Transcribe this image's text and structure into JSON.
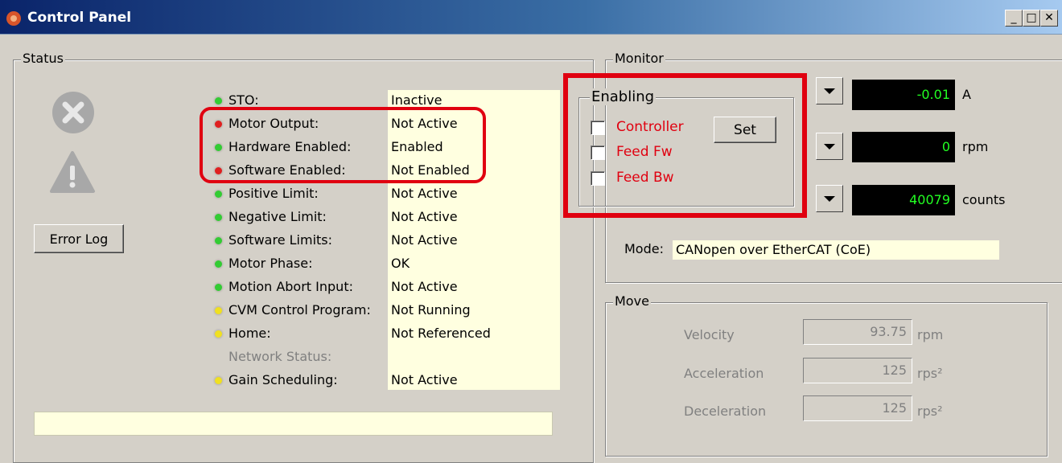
{
  "window": {
    "title": "Control Panel",
    "buttons": {
      "minimize": "_",
      "maximize": "□",
      "close": "✕"
    }
  },
  "status": {
    "group_label": "Status",
    "error_log_label": "Error Log",
    "items": [
      {
        "label": "STO:",
        "value": "Inactive",
        "led": "green"
      },
      {
        "label": "Motor Output:",
        "value": "Not Active",
        "led": "red"
      },
      {
        "label": "Hardware Enabled:",
        "value": "Enabled",
        "led": "green"
      },
      {
        "label": "Software Enabled:",
        "value": "Not Enabled",
        "led": "red"
      },
      {
        "label": "Positive Limit:",
        "value": "Not Active",
        "led": "green"
      },
      {
        "label": "Negative Limit:",
        "value": "Not Active",
        "led": "green"
      },
      {
        "label": "Software Limits:",
        "value": "Not Active",
        "led": "green"
      },
      {
        "label": "Motor Phase:",
        "value": "OK",
        "led": "green"
      },
      {
        "label": "Motion Abort Input:",
        "value": "Not Active",
        "led": "green"
      },
      {
        "label": "CVM Control Program:",
        "value": "Not Running",
        "led": "yellow"
      },
      {
        "label": "Home:",
        "value": "Not Referenced",
        "led": "yellow"
      },
      {
        "label": "Network Status:",
        "value": "",
        "led": "none"
      },
      {
        "label": "Gain Scheduling:",
        "value": "Not Active",
        "led": "yellow"
      }
    ],
    "led_colors": {
      "green": "#33cc33",
      "red": "#e02020",
      "yellow": "#f0e020"
    },
    "message": ""
  },
  "monitor": {
    "group_label": "Monitor",
    "readouts": [
      {
        "value": "-0.01",
        "unit": "A"
      },
      {
        "value": "0",
        "unit": "rpm"
      },
      {
        "value": "40079",
        "unit": "counts"
      }
    ],
    "mode_label": "Mode:",
    "mode_value": "CANopen over EtherCAT (CoE)"
  },
  "enabling": {
    "group_label": "Enabling",
    "set_label": "Set",
    "checkboxes": [
      {
        "label": "Controller",
        "checked": false
      },
      {
        "label": "Feed Fw",
        "checked": false
      },
      {
        "label": "Feed Bw",
        "checked": false
      }
    ]
  },
  "move": {
    "group_label": "Move",
    "fields": [
      {
        "label": "Velocity",
        "value": "93.75",
        "unit": "rpm"
      },
      {
        "label": "Acceleration",
        "value": "125",
        "unit": "rps²"
      },
      {
        "label": "Deceleration",
        "value": "125",
        "unit": "rps²"
      }
    ]
  },
  "colors": {
    "highlight": "#e00010",
    "panel": "#ffffe0",
    "lcd_text": "#22ff22"
  }
}
